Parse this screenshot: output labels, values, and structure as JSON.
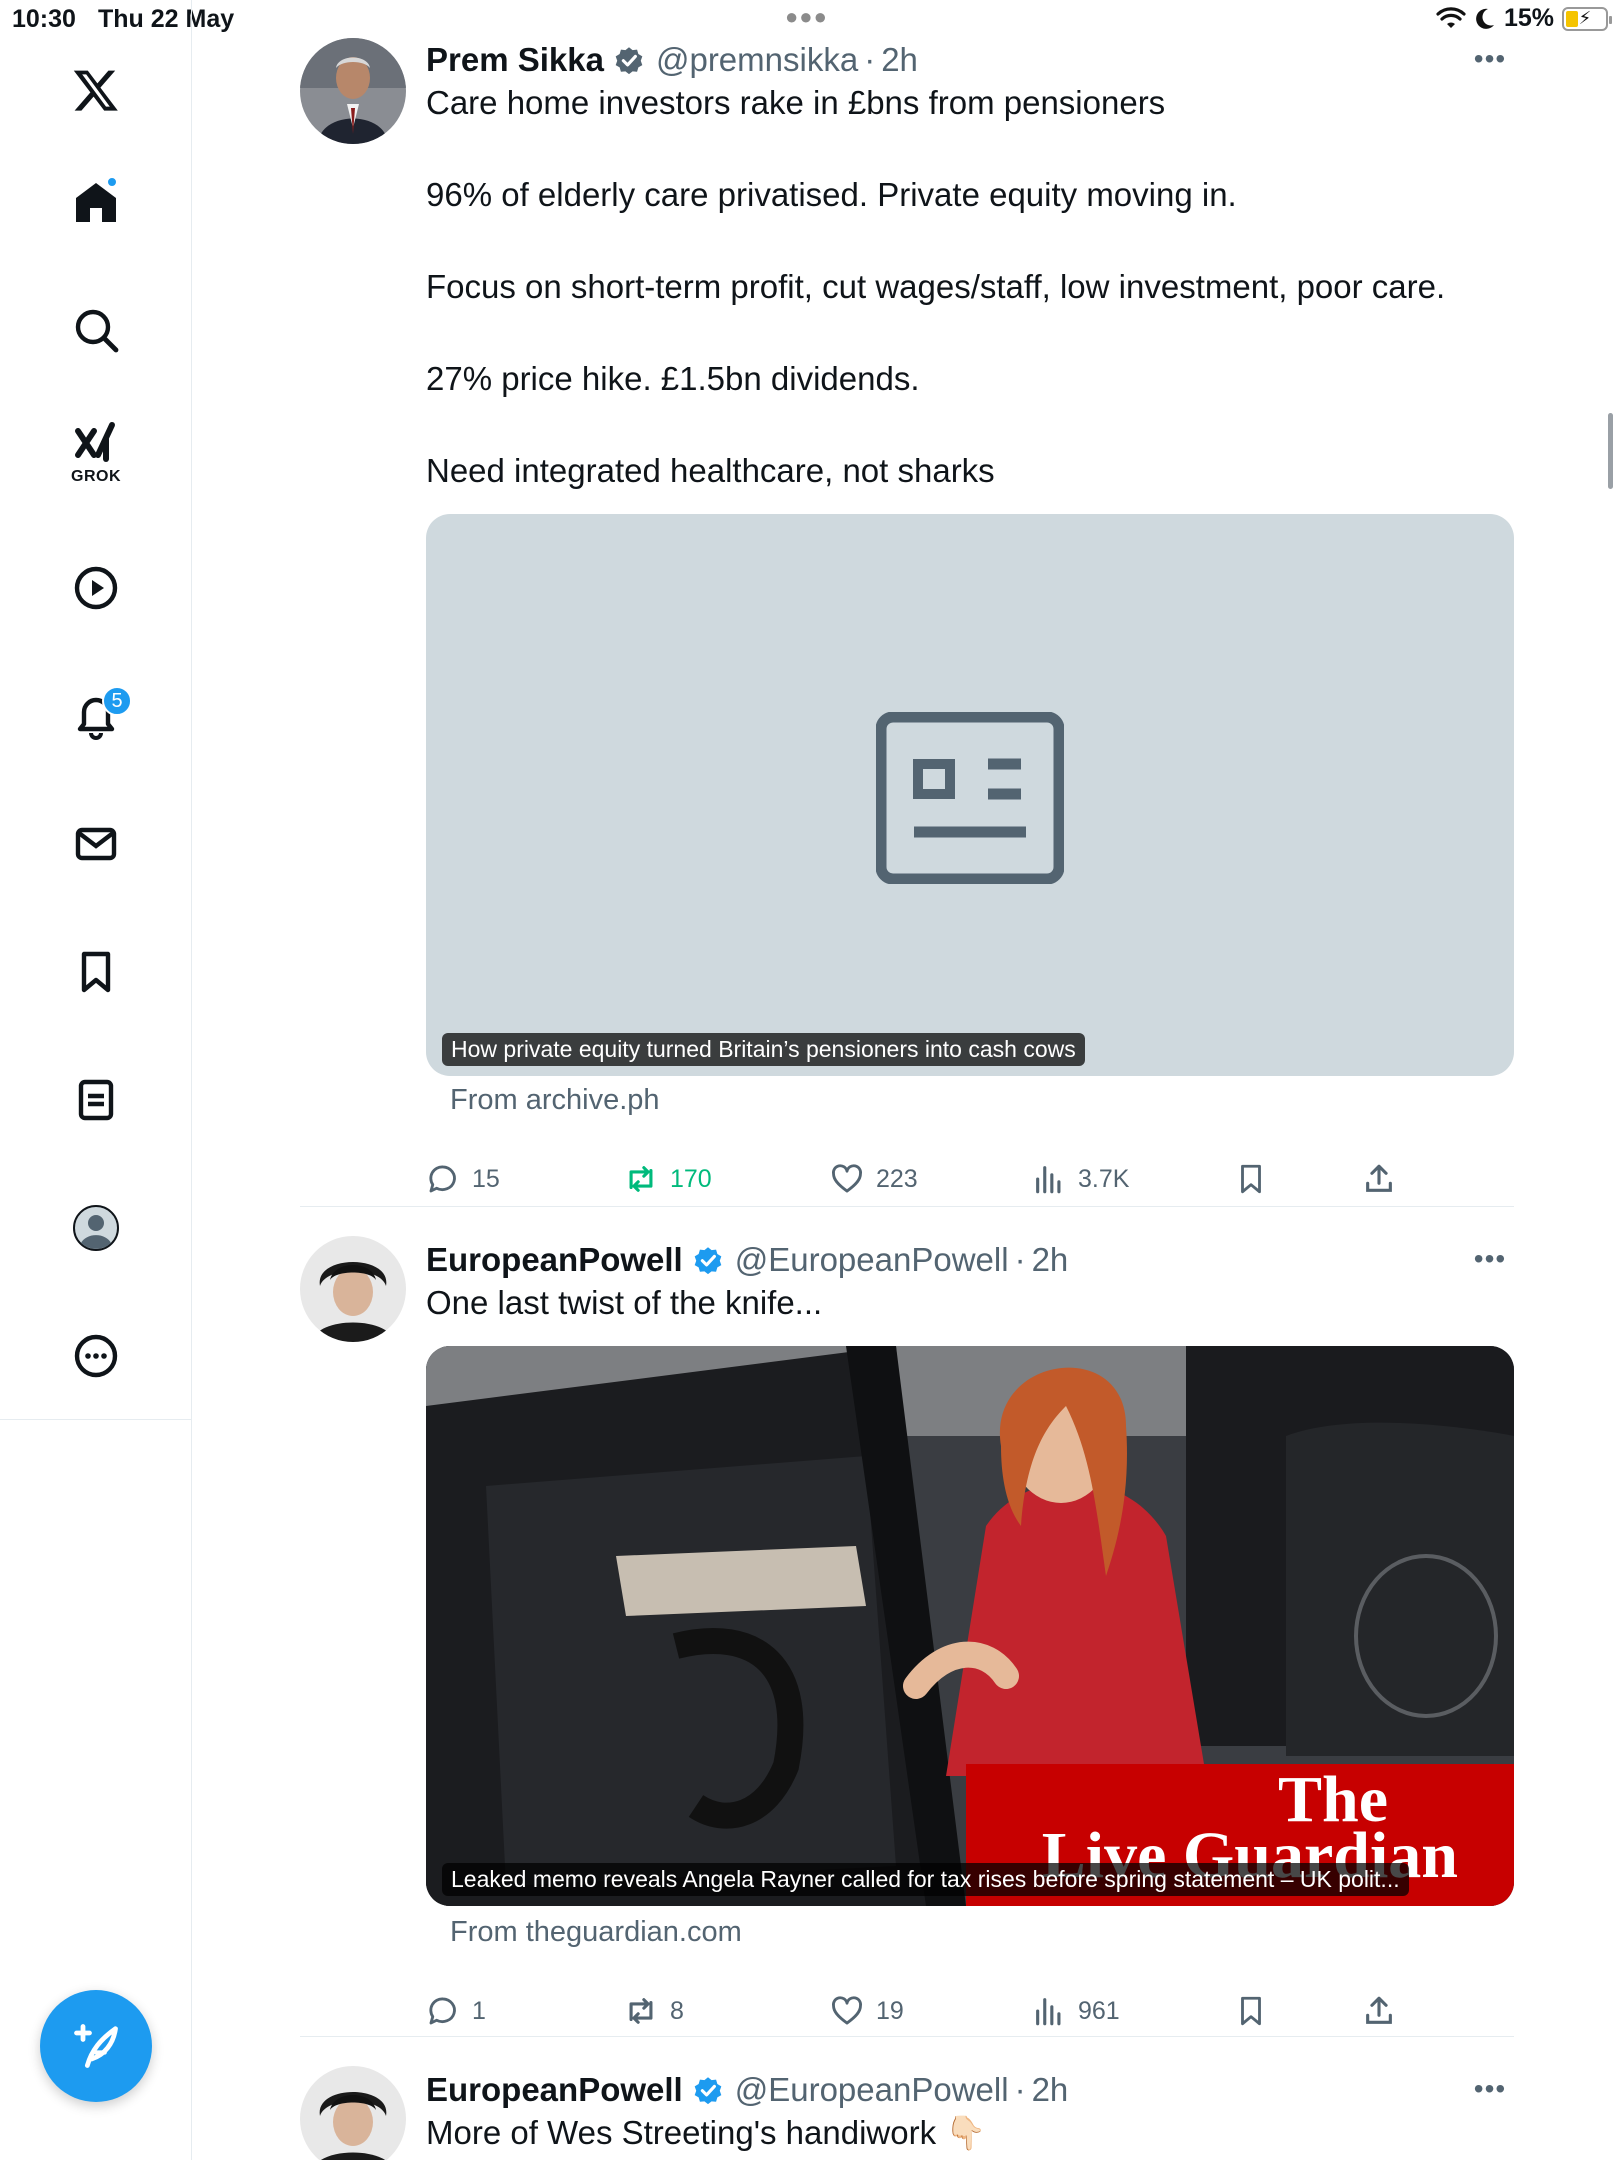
{
  "status": {
    "time": "10:30",
    "date": "Thu 22 May",
    "battery": "15%"
  },
  "nav": {
    "grok_label": "GROK",
    "notifications_badge": "5"
  },
  "tweets": [
    {
      "name": "Prem Sikka",
      "handle": "@premnsikka",
      "time": "2h",
      "lines": [
        "Care home investors rake in £bns from pensioners",
        "96% of elderly care privatised. Private equity moving in.",
        "Focus on short-term profit, cut wages/staff, low investment, poor care.",
        "27% price hike. £1.5bn dividends.",
        "Need integrated healthcare, not sharks"
      ],
      "card_caption": "How private equity turned Britain’s pensioners into cash cows",
      "card_from": "From archive.ph",
      "replies": "15",
      "reposts": "170",
      "likes": "223",
      "views": "3.7K"
    },
    {
      "name": "EuropeanPowell",
      "handle": "@EuropeanPowell",
      "time": "2h",
      "lines": [
        "One last twist of the knife..."
      ],
      "card_caption": "Leaked memo reveals Angela Rayner called for tax rises before spring statement – UK polit...",
      "card_logo_top": "The",
      "card_logo_bottom": "Live Guardian",
      "card_from": "From theguardian.com",
      "replies": "1",
      "reposts": "8",
      "likes": "19",
      "views": "961"
    },
    {
      "name": "EuropeanPowell",
      "handle": "@EuropeanPowell",
      "time": "2h",
      "lines": [
        "More of Wes Streeting's handiwork 👇🏻"
      ]
    }
  ],
  "colors": {
    "accent": "#1d9bf0",
    "repost_active": "#00ba7c",
    "secondary_text": "#536471",
    "card_placeholder": "#cfd9de"
  }
}
